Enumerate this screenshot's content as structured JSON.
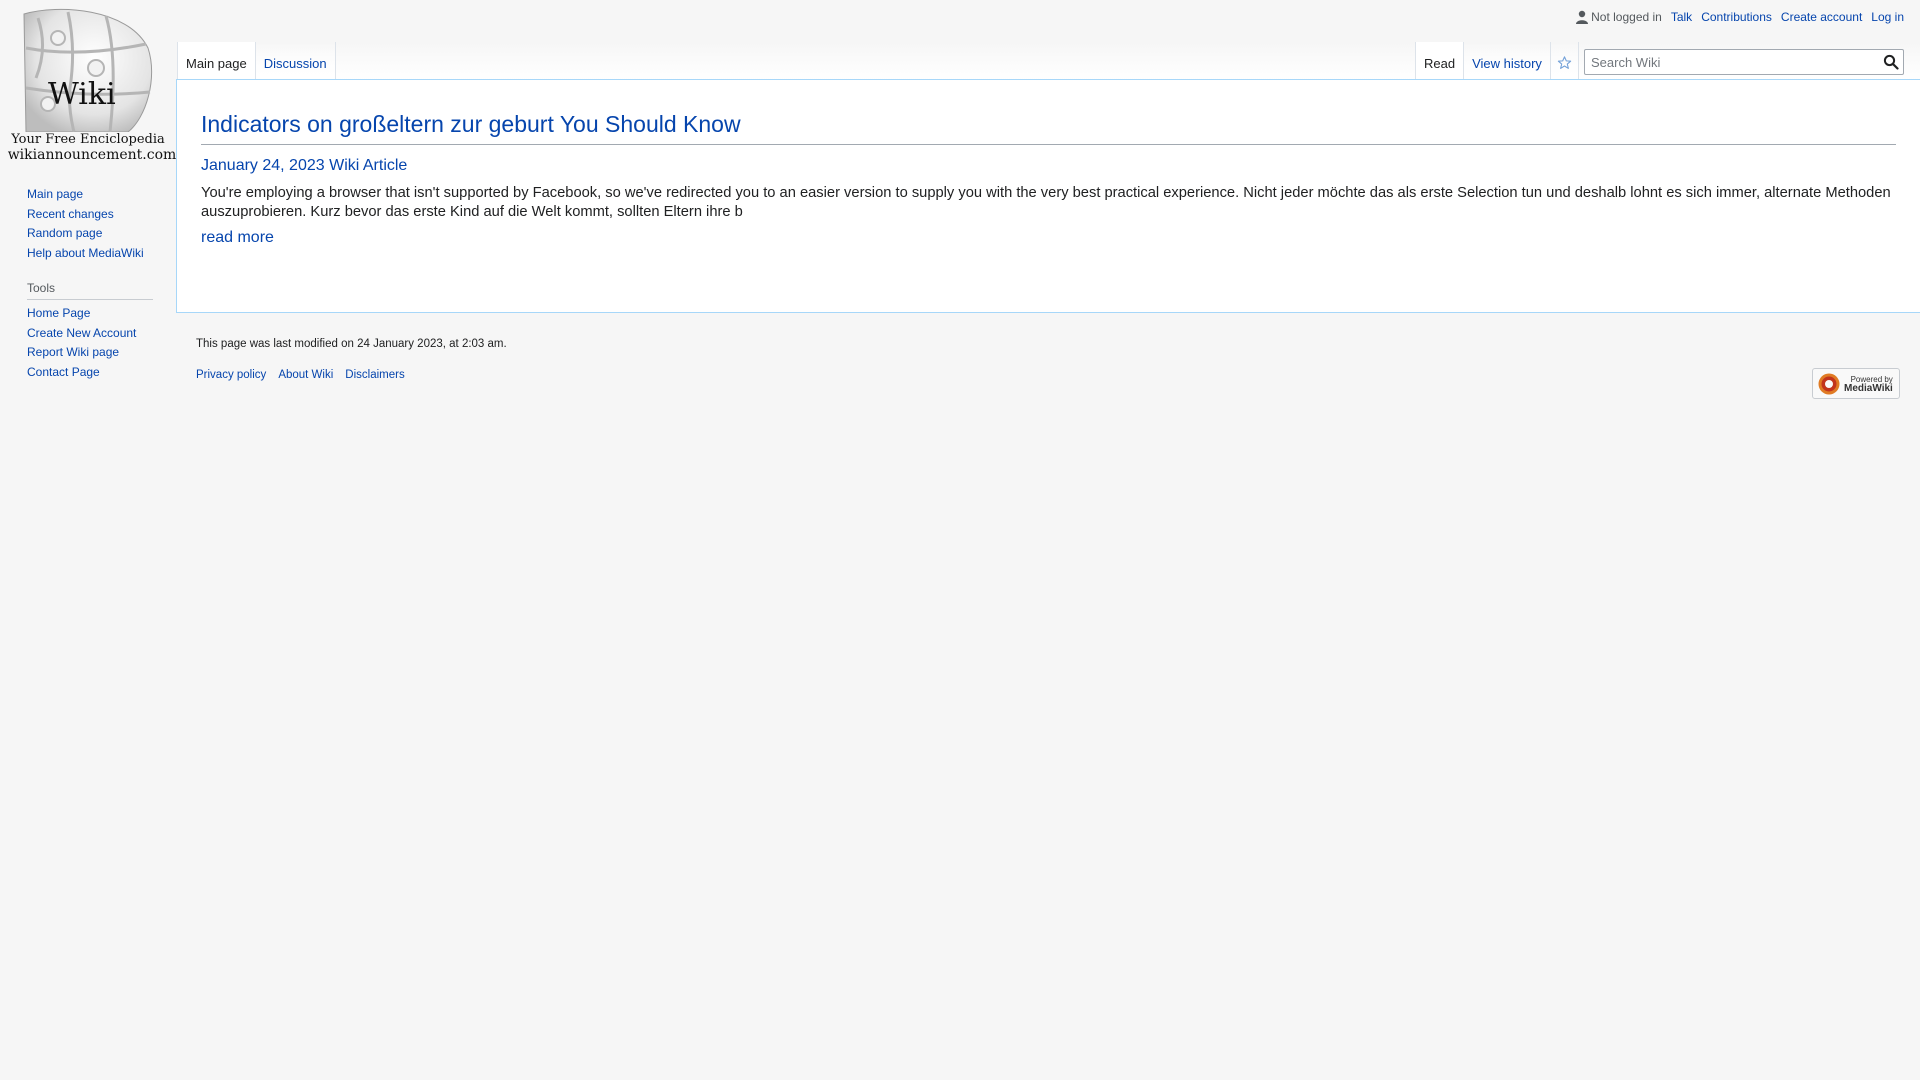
{
  "logo": {
    "wordmark": "Wiki",
    "tagline": "Your Free Enciclopedia",
    "domain": "wikiannouncement.com"
  },
  "sidebar": {
    "navigation": [
      {
        "label": "Main page"
      },
      {
        "label": "Recent changes"
      },
      {
        "label": "Random page"
      },
      {
        "label": "Help about MediaWiki"
      }
    ],
    "tools_heading": "Tools",
    "tools": [
      {
        "label": "Home Page"
      },
      {
        "label": "Create New Account"
      },
      {
        "label": "Report Wiki page"
      },
      {
        "label": "Contact Page"
      }
    ]
  },
  "personal": {
    "status": "Not logged in",
    "links": [
      "Talk",
      "Contributions",
      "Create account",
      "Log in"
    ]
  },
  "tabs": {
    "left": [
      {
        "label": "Main page",
        "selected": true
      },
      {
        "label": "Discussion",
        "selected": false
      }
    ],
    "right": [
      {
        "label": "Read",
        "selected": true
      },
      {
        "label": "View history",
        "selected": false
      }
    ],
    "watch_icon": "star-icon"
  },
  "search": {
    "placeholder": "Search Wiki",
    "value": "",
    "button_icon": "search-icon"
  },
  "article": {
    "title": "Indicators on großeltern zur geburt You Should Know",
    "meta": "January 24, 2023 Wiki Article",
    "excerpt": "You're employing a browser that isn't supported by Facebook, so we've redirected you to an easier version to supply you with the very best practical experience. Nicht jeder möchte das als erste Selection tun und deshalb lohnt es sich immer, alternate Methoden auszuprobieren. Kurz bevor das erste Kind auf die Welt kommt, sollten Eltern ihre b",
    "read_more": "read more"
  },
  "footer": {
    "modified": "This page was last modified on 24 January 2023, at 2:03 am.",
    "links": [
      "Privacy policy",
      "About Wiki",
      "Disclaimers"
    ],
    "powered_line1": "Powered by",
    "powered_line2": "MediaWiki"
  },
  "colors": {
    "link": "#0645ad",
    "text": "#202122",
    "background": "#f6f6f6",
    "content_border": "#a7d7f9"
  }
}
